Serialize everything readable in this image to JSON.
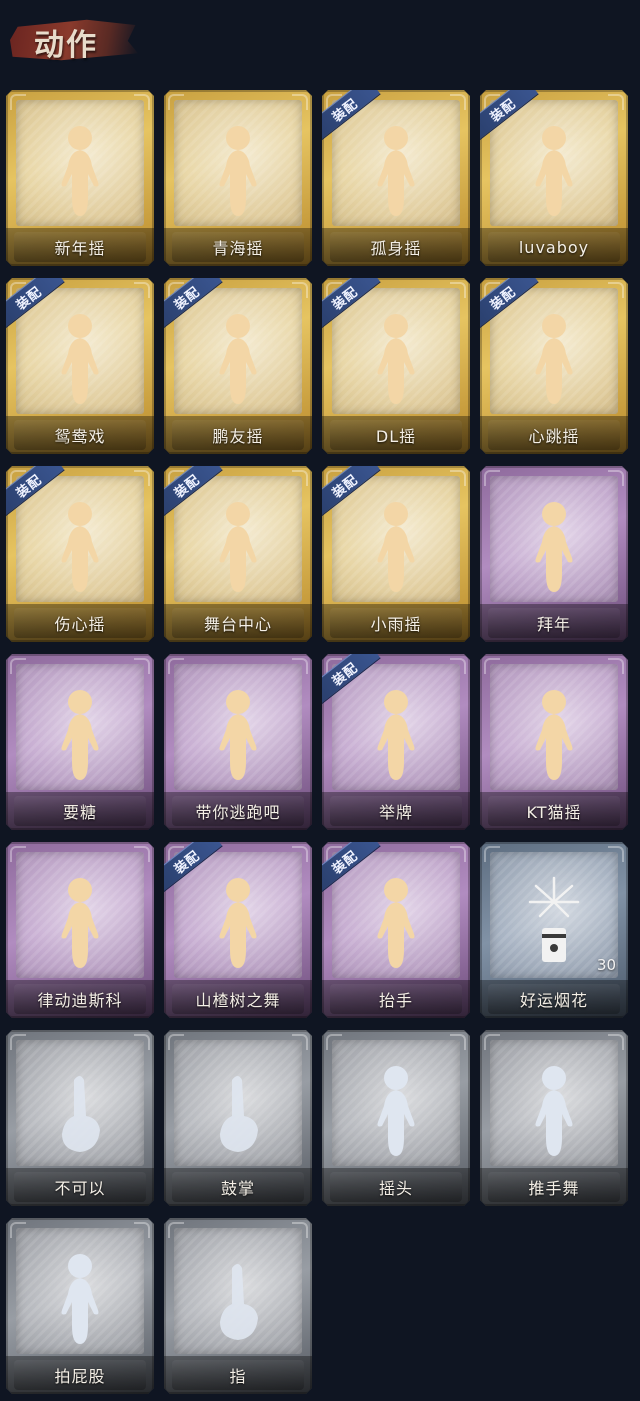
{
  "header": {
    "title": "动作"
  },
  "badge_text": "装配",
  "rarity_colors": {
    "gold": "#e6c461",
    "purple": "#b18cc0",
    "blue": "#8192a6",
    "grey": "#989da4"
  },
  "emotes": [
    {
      "label": "新年摇",
      "rarity": "gold",
      "equipped": false,
      "icon": "figure-clapping-icon"
    },
    {
      "label": "青海摇",
      "rarity": "gold",
      "equipped": false,
      "icon": "figure-dancing-icon"
    },
    {
      "label": "孤身摇",
      "rarity": "gold",
      "equipped": true,
      "icon": "figure-dancing-icon"
    },
    {
      "label": "luvaboy",
      "rarity": "gold",
      "equipped": true,
      "icon": "figure-dancing-icon"
    },
    {
      "label": "鸳鸯戏",
      "rarity": "gold",
      "equipped": true,
      "icon": "figure-dancing-icon"
    },
    {
      "label": "鹏友摇",
      "rarity": "gold",
      "equipped": true,
      "icon": "figure-dancing-icon"
    },
    {
      "label": "DL摇",
      "rarity": "gold",
      "equipped": true,
      "icon": "figure-arm-raised-icon"
    },
    {
      "label": "心跳摇",
      "rarity": "gold",
      "equipped": true,
      "icon": "figure-dancing-icon"
    },
    {
      "label": "伤心摇",
      "rarity": "gold",
      "equipped": true,
      "icon": "figure-heart-hands-icon"
    },
    {
      "label": "舞台中心",
      "rarity": "gold",
      "equipped": true,
      "icon": "figure-posing-icon"
    },
    {
      "label": "小雨摇",
      "rarity": "gold",
      "equipped": true,
      "icon": "figure-dancing-icon"
    },
    {
      "label": "拜年",
      "rarity": "purple",
      "equipped": false,
      "icon": "figure-bowing-icon"
    },
    {
      "label": "要糖",
      "rarity": "purple",
      "equipped": false,
      "icon": "figure-reaching-icon"
    },
    {
      "label": "带你逃跑吧",
      "rarity": "purple",
      "equipped": false,
      "icon": "figure-running-icon"
    },
    {
      "label": "举牌",
      "rarity": "purple",
      "equipped": true,
      "icon": "figure-holding-sign-icon"
    },
    {
      "label": "KT猫摇",
      "rarity": "purple",
      "equipped": false,
      "icon": "figure-dancing-icon"
    },
    {
      "label": "律动迪斯科",
      "rarity": "purple",
      "equipped": false,
      "icon": "figure-disco-icon"
    },
    {
      "label": "山楂树之舞",
      "rarity": "purple",
      "equipped": true,
      "icon": "figure-arm-raised-icon"
    },
    {
      "label": "抬手",
      "rarity": "purple",
      "equipped": true,
      "icon": "figure-raising-hand-icon"
    },
    {
      "label": "好运烟花",
      "rarity": "blue",
      "equipped": false,
      "icon": "firework-icon",
      "count": "30"
    },
    {
      "label": "不可以",
      "rarity": "grey",
      "equipped": false,
      "icon": "finger-wag-icon"
    },
    {
      "label": "鼓掌",
      "rarity": "grey",
      "equipped": false,
      "icon": "clapping-hands-icon"
    },
    {
      "label": "摇头",
      "rarity": "grey",
      "equipped": false,
      "icon": "figure-shaking-head-icon"
    },
    {
      "label": "推手舞",
      "rarity": "grey",
      "equipped": false,
      "icon": "figure-pushing-icon"
    },
    {
      "label": "拍屁股",
      "rarity": "grey",
      "equipped": false,
      "icon": "figure-patting-icon"
    },
    {
      "label": "指",
      "rarity": "grey",
      "equipped": false,
      "icon": "pointing-hand-icon"
    }
  ]
}
